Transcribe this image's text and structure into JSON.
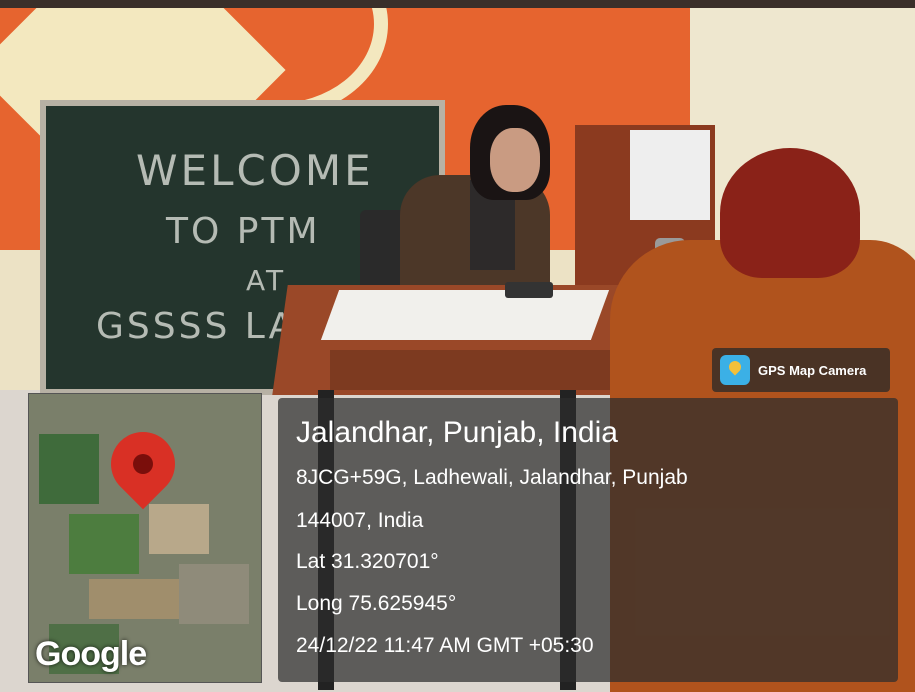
{
  "board": {
    "line1": "WELCOME",
    "line2": "TO PTM",
    "line3": "AT",
    "line4": "GSSSS LAD"
  },
  "gps_badge": {
    "app_name": "GPS Map Camera",
    "icon": "gps-map-camera-app-icon"
  },
  "map": {
    "logo": "Google",
    "pin_icon": "location-pin-icon"
  },
  "location": {
    "title": "Jalandhar, Punjab, India",
    "address_line1": "8JCG+59G, Ladhewali, Jalandhar, Punjab",
    "address_line2": "144007, India",
    "latitude": "Lat 31.320701°",
    "longitude": "Long 75.625945°",
    "timestamp": "24/12/22 11:47 AM GMT +05:30"
  },
  "colors": {
    "wall_orange": "#e6642f",
    "pin_red": "#d93025",
    "overlay_bg": "#2d2d2d"
  }
}
